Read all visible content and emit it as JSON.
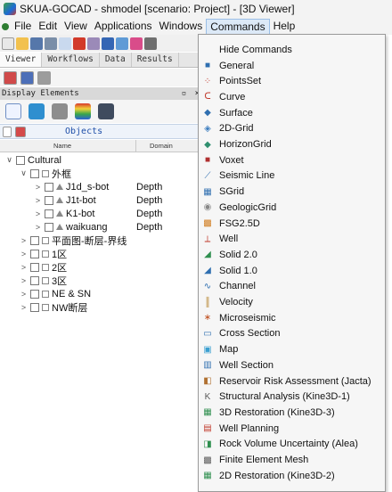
{
  "window": {
    "title": "SKUA-GOCAD - shmodel  [scenario: Project] - [3D Viewer]"
  },
  "menubar": {
    "items": [
      "File",
      "Edit",
      "View",
      "Applications",
      "Windows",
      "Commands",
      "Help"
    ],
    "active": "Commands"
  },
  "tabs": [
    "Viewer",
    "Workflows",
    "Data",
    "Results"
  ],
  "panel": {
    "title": "Display Elements",
    "objects_label": "Objects"
  },
  "columns": {
    "name": "Name",
    "domain": "Domain"
  },
  "tree": [
    {
      "label": "Cultural",
      "domain": "",
      "level": 0,
      "expanded": true,
      "icon": "none"
    },
    {
      "label": "外框",
      "domain": "",
      "level": 1,
      "expanded": true,
      "icon": "square"
    },
    {
      "label": "J1d_s-bot",
      "domain": "Depth",
      "level": 2,
      "expanded": false,
      "icon": "triangle"
    },
    {
      "label": "J1t-bot",
      "domain": "Depth",
      "level": 2,
      "expanded": false,
      "icon": "triangle"
    },
    {
      "label": "K1-bot",
      "domain": "Depth",
      "level": 2,
      "expanded": false,
      "icon": "triangle"
    },
    {
      "label": "waikuang",
      "domain": "Depth",
      "level": 2,
      "expanded": false,
      "icon": "triangle"
    },
    {
      "label": "平面图-断层-界线",
      "domain": "",
      "level": 1,
      "expanded": false,
      "icon": "square"
    },
    {
      "label": "1区",
      "domain": "",
      "level": 1,
      "expanded": false,
      "icon": "square"
    },
    {
      "label": "2区",
      "domain": "",
      "level": 1,
      "expanded": false,
      "icon": "square"
    },
    {
      "label": "3区",
      "domain": "",
      "level": 1,
      "expanded": false,
      "icon": "square"
    },
    {
      "label": "NE & SN",
      "domain": "",
      "level": 1,
      "expanded": false,
      "icon": "square"
    },
    {
      "label": "NW断层",
      "domain": "",
      "level": 1,
      "expanded": false,
      "icon": "square"
    }
  ],
  "commands_menu": [
    {
      "label": "Hide Commands",
      "icon": "none"
    },
    {
      "label": "General",
      "icon": "general-icon"
    },
    {
      "label": "PointsSet",
      "icon": "pointsset-icon"
    },
    {
      "label": "Curve",
      "icon": "curve-icon"
    },
    {
      "label": "Surface",
      "icon": "surface-icon"
    },
    {
      "label": "2D-Grid",
      "icon": "2d-grid-icon"
    },
    {
      "label": "HorizonGrid",
      "icon": "horizongrid-icon"
    },
    {
      "label": "Voxet",
      "icon": "voxet-icon"
    },
    {
      "label": "Seismic Line",
      "icon": "seismic-line-icon"
    },
    {
      "label": "SGrid",
      "icon": "sgrid-icon"
    },
    {
      "label": "GeologicGrid",
      "icon": "geologicgrid-icon"
    },
    {
      "label": "FSG2.5D",
      "icon": "fsg25d-icon"
    },
    {
      "label": "Well",
      "icon": "well-icon"
    },
    {
      "label": "Solid 2.0",
      "icon": "solid-2-icon"
    },
    {
      "label": "Solid 1.0",
      "icon": "solid-1-icon"
    },
    {
      "label": "Channel",
      "icon": "channel-icon"
    },
    {
      "label": "Velocity",
      "icon": "velocity-icon"
    },
    {
      "label": "Microseismic",
      "icon": "microseismic-icon"
    },
    {
      "label": "Cross Section",
      "icon": "cross-section-icon"
    },
    {
      "label": "Map",
      "icon": "map-icon"
    },
    {
      "label": "Well Section",
      "icon": "well-section-icon"
    },
    {
      "label": "Reservoir Risk Assessment (Jacta)",
      "icon": "reservoir-risk-icon"
    },
    {
      "label": "Structural Analysis (Kine3D-1)",
      "icon": "structural-analysis-icon"
    },
    {
      "label": "3D Restoration (Kine3D-3)",
      "icon": "3d-restoration-icon"
    },
    {
      "label": "Well Planning",
      "icon": "well-planning-icon"
    },
    {
      "label": "Rock Volume Uncertainty (Alea)",
      "icon": "rock-volume-icon"
    },
    {
      "label": "Finite Element Mesh",
      "icon": "finite-element-icon"
    },
    {
      "label": "2D Restoration (Kine3D-2)",
      "icon": "2d-restoration-icon"
    }
  ]
}
